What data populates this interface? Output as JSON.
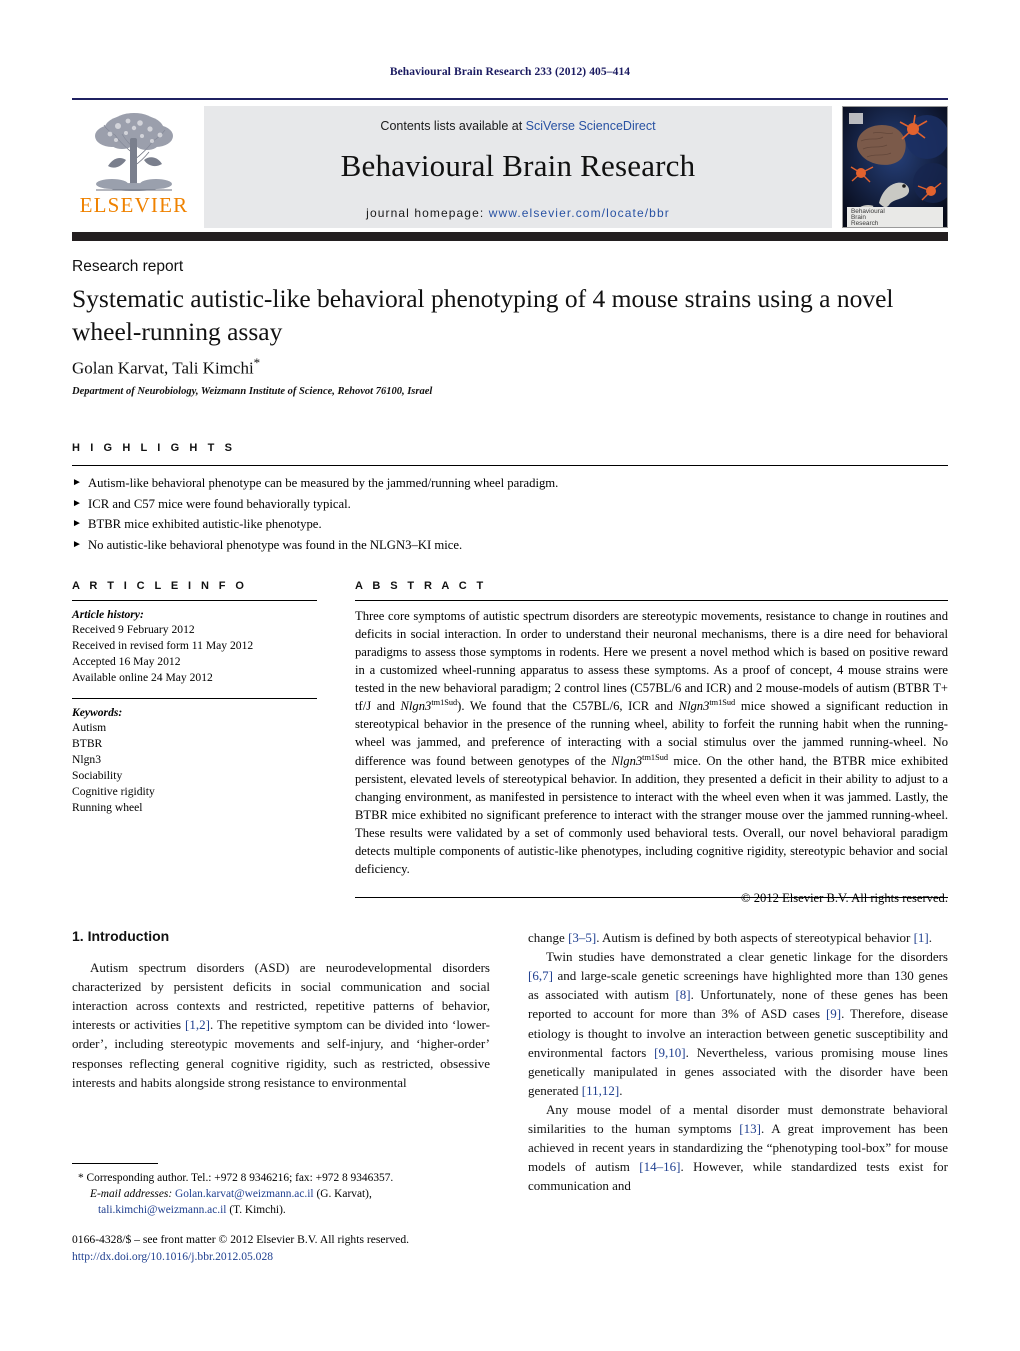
{
  "running_head": "Behavioural Brain Research 233 (2012) 405–414",
  "masthead": {
    "contents_prefix": "Contents lists available at ",
    "contents_link": "SciVerse ScienceDirect",
    "journal_name": "Behavioural Brain Research",
    "homepage_prefix": "journal homepage:",
    "homepage_url": "www.elsevier.com/locate/bbr",
    "publisher_wordmark": "ELSEVIER",
    "publisher_logo_icon": "elsevier-tree-logo",
    "cover_caption_line1": "Behavioural",
    "cover_caption_line2": "Brain",
    "cover_caption_line3": "Research",
    "accent_orange": "#ef8200",
    "link_blue": "#2952a3",
    "rule_navy": "#1f2161",
    "band_gray": "#e7e8ea"
  },
  "article": {
    "kicker": "Research report",
    "title": "Systematic autistic-like behavioral phenotyping of 4 mouse strains using a novel wheel-running assay",
    "authors": "Golan Karvat, Tali Kimchi",
    "corresponding_marker": "*",
    "affiliation": "Department of Neurobiology, Weizmann Institute of Science, Rehovot 76100, Israel"
  },
  "highlights": {
    "heading": "H I G H L I G H T S",
    "bullet_icon": "triangle-right-bullet",
    "items": [
      "Autism-like behavioral phenotype can be measured by the jammed/running wheel paradigm.",
      "ICR and C57 mice were found behaviorally typical.",
      "BTBR mice exhibited autistic-like phenotype.",
      "No autistic-like behavioral phenotype was found in the NLGN3–KI mice."
    ]
  },
  "article_info": {
    "heading": "A R T I C L E    I N F O",
    "history_title": "Article history:",
    "history": [
      "Received 9 February 2012",
      "Received in revised form 11 May 2012",
      "Accepted 16 May 2012",
      "Available online 24 May 2012"
    ],
    "keywords_title": "Keywords:",
    "keywords": [
      "Autism",
      "BTBR",
      "Nlgn3",
      "Sociability",
      "Cognitive rigidity",
      "Running wheel"
    ]
  },
  "abstract": {
    "heading": "A B S T R A C T",
    "part1": "Three core symptoms of autistic spectrum disorders are stereotypic movements, resistance to change in routines and deficits in social interaction. In order to understand their neuronal mechanisms, there is a dire need for behavioral paradigms to assess those symptoms in rodents. Here we present a novel method which is based on positive reward in a customized wheel-running apparatus to assess these symptoms. As a proof of concept, 4 mouse strains were tested in the new behavioral paradigm; 2 control lines (C57BL/6 and ICR) and 2 mouse-models of autism (BTBR T+ tf/J and ",
    "gene1": "Nlgn3",
    "gene1_sup": "tm1Sud",
    "part2": "). We found that the C57BL/6, ICR and ",
    "gene2": "Nlgn3",
    "gene2_sup": "tm1Sud",
    "part3": " mice showed a significant reduction in stereotypical behavior in the presence of the running wheel, ability to forfeit the running habit when the running-wheel was jammed, and preference of interacting with a social stimulus over the jammed running-wheel. No difference was found between genotypes of the ",
    "gene3": "Nlgn3",
    "gene3_sup": "tm1Sud",
    "part4": " mice. On the other hand, the BTBR mice exhibited persistent, elevated levels of stereotypical behavior. In addition, they presented a deficit in their ability to adjust to a changing environment, as manifested in persistence to interact with the wheel even when it was jammed. Lastly, the BTBR mice exhibited no significant preference to interact with the stranger mouse over the jammed running-wheel. These results were validated by a set of commonly used behavioral tests. Overall, our novel behavioral paradigm detects multiple components of autistic-like phenotypes, including cognitive rigidity, stereotypic behavior and social deficiency.",
    "copyright": "© 2012 Elsevier B.V. All rights reserved."
  },
  "introduction": {
    "section_number": "1.",
    "section_title": "Introduction",
    "left_p1_a": "Autism spectrum disorders (ASD) are neurodevelopmental disorders characterized by persistent deficits in social communication and social interaction across contexts and restricted, repetitive patterns of behavior, interests or activities ",
    "left_ref1": "[1,2]",
    "left_p1_b": ". The repetitive symptom can be divided into ‘lower-order’, including stereotypic movements and self-injury, and ‘higher-order’ responses reflecting general cognitive rigidity, such as restricted, obsessive interests and habits alongside strong resistance to environmental ",
    "right_p1_cont": "change ",
    "right_ref1": "[3–5]",
    "right_p1_b": ". Autism is defined by both aspects of stereotypical behavior ",
    "right_ref2": "[1]",
    "right_p1_c": ".",
    "right_p2_a": "Twin studies have demonstrated a clear genetic linkage for the disorders ",
    "right_ref3": "[6,7]",
    "right_p2_b": " and large-scale genetic screenings have highlighted more than 130 genes as associated with autism ",
    "right_ref4": "[8]",
    "right_p2_c": ". Unfortunately, none of these genes has been reported to account for more than 3% of ASD cases ",
    "right_ref5": "[9]",
    "right_p2_d": ". Therefore, disease etiology is thought to involve an interaction between genetic susceptibility and environmental factors ",
    "right_ref6": "[9,10]",
    "right_p2_e": ". Nevertheless, various promising mouse lines genetically manipulated in genes associated with the disorder have been generated ",
    "right_ref7": "[11,12]",
    "right_p2_f": ".",
    "right_p3_a": "Any mouse model of a mental disorder must demonstrate behavioral similarities to the human symptoms ",
    "right_ref8": "[13]",
    "right_p3_b": ". A great improvement has been achieved in recent years in standardizing the “phenotyping tool-box” for mouse models of autism ",
    "right_ref9": "[14–16]",
    "right_p3_c": ". However, while standardized tests exist for communication and"
  },
  "footnote": {
    "corresponding_marker": "*",
    "corresponding_text": " Corresponding author. Tel.: +972 8 9346216; fax: +972 8 9346357.",
    "email_label": "E-mail addresses:",
    "email1": "Golan.karvat@weizmann.ac.il",
    "email1_owner": " (G. Karvat),",
    "email2": "tali.kimchi@weizmann.ac.il",
    "email2_owner": " (T. Kimchi).",
    "imprint": "0166-4328/$ – see front matter © 2012 Elsevier B.V. All rights reserved.",
    "doi": "http://dx.doi.org/10.1016/j.bbr.2012.05.028"
  }
}
